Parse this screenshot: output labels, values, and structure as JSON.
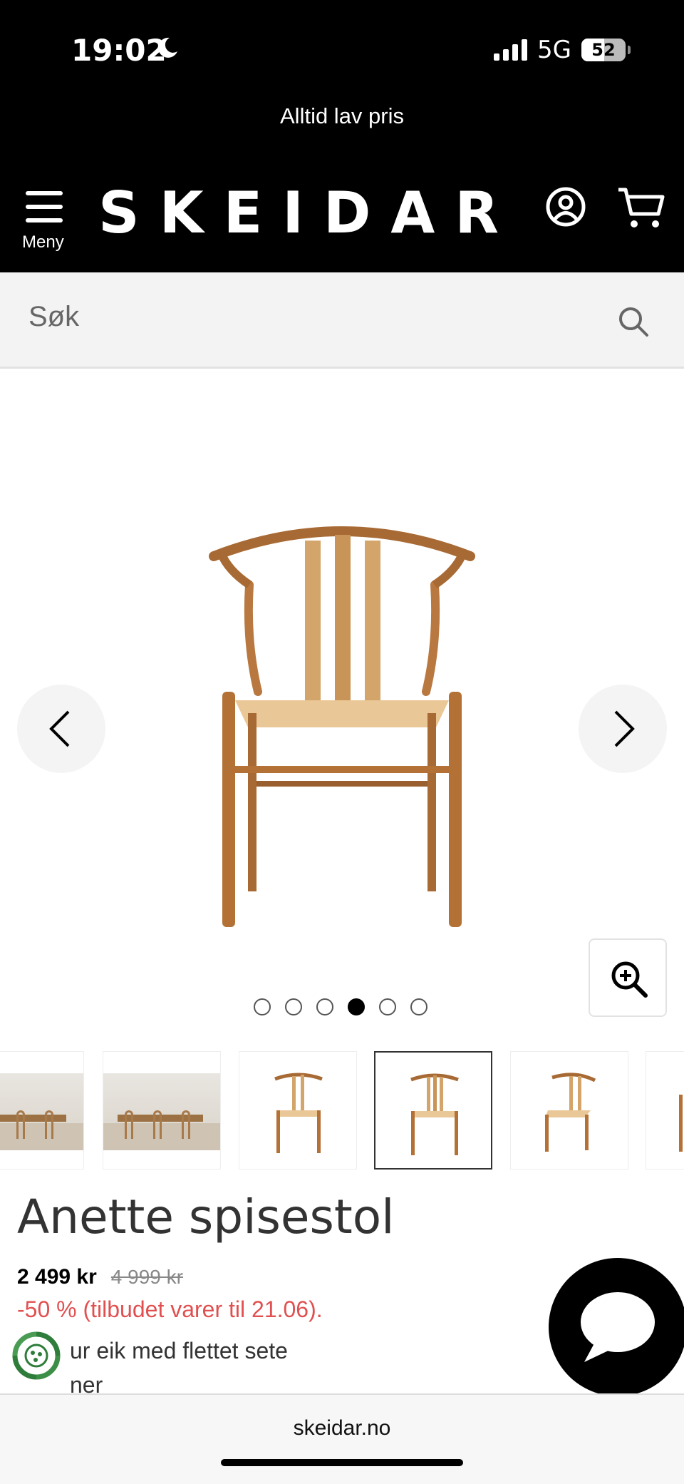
{
  "status_bar": {
    "time": "19:02",
    "network": "5G",
    "battery": "52"
  },
  "promo": {
    "text": "Alltid lav pris"
  },
  "header": {
    "logo": "SKEIDAR",
    "menu_label": "Meny"
  },
  "search": {
    "placeholder": "Søk"
  },
  "gallery": {
    "dots_count": 6,
    "active_index": 3,
    "thumbnails": [
      "room",
      "room",
      "chair",
      "chair",
      "chair",
      "chair"
    ],
    "selected_thumbnail": 3
  },
  "product": {
    "title": "Anette spisestol",
    "price": "2 499 kr",
    "old_price": "4 999 kr",
    "discount": "-50 % (tilbudet varer til 21.06).",
    "desc_line1": "ur eik med flettet sete",
    "desc_line2": "ner"
  },
  "browser": {
    "url": "skeidar.no"
  },
  "colors": {
    "discount": "#e15050",
    "header_bg": "#000000"
  }
}
